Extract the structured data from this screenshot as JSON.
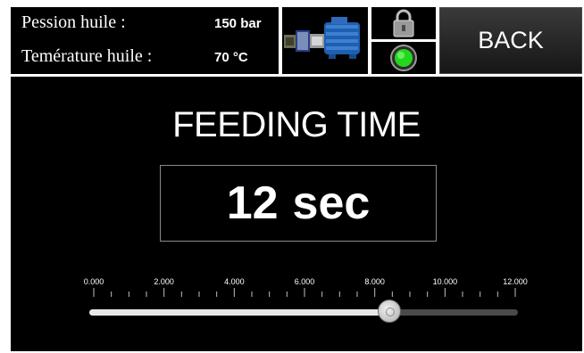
{
  "header": {
    "pressure_label": "Pession huile :",
    "pressure_value": "150 bar",
    "temperature_label": "Temérature huile :",
    "temperature_value": "70 °C",
    "back_label": "BACK"
  },
  "icons": {
    "motor": "motor-pump-icon",
    "lock": "padlock-icon",
    "status_led": "status-led-icon"
  },
  "colors": {
    "led": "#22d81c",
    "motor_body": "#1d5fb0",
    "background": "#000000"
  },
  "main": {
    "title": "FEEDING TIME",
    "value": "12",
    "unit": "sec"
  },
  "slider": {
    "min": 0,
    "max": 12,
    "value": 8.4,
    "major_ticks": [
      "0.000",
      "2.000",
      "4.000",
      "6.000",
      "8.000",
      "10.000",
      "12.000"
    ]
  }
}
